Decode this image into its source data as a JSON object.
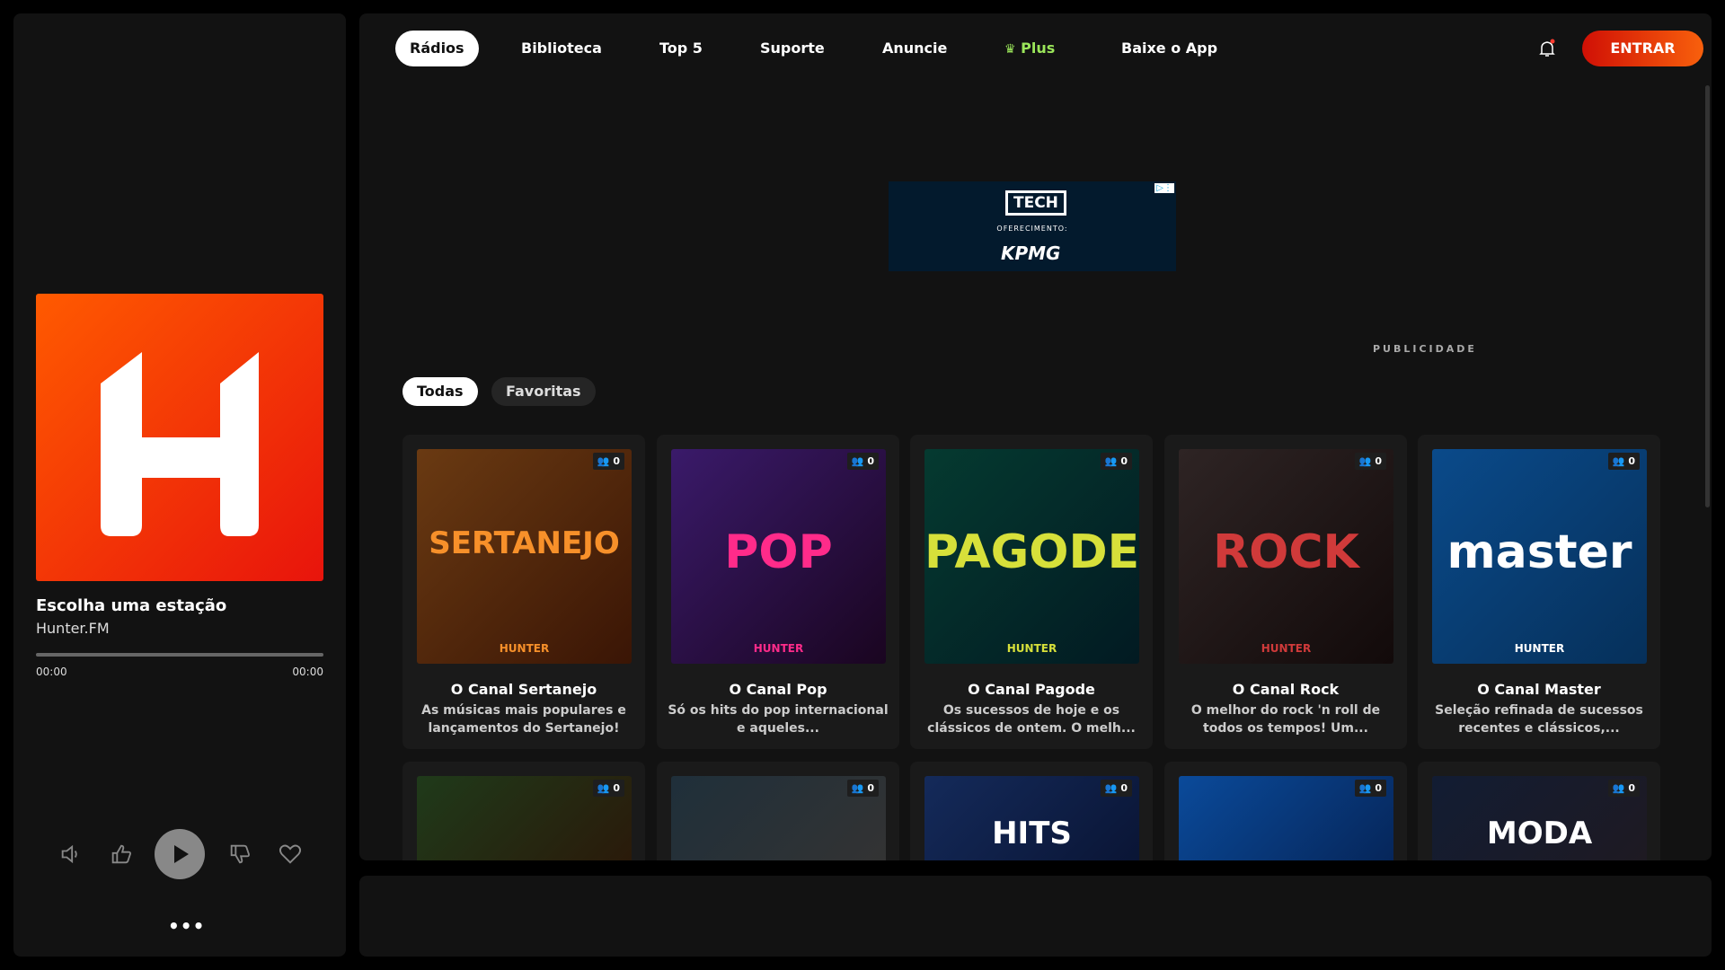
{
  "player": {
    "title": "Escolha uma estação",
    "subtitle": "Hunter.FM",
    "time_current": "00:00",
    "time_total": "00:00",
    "progress": 0
  },
  "nav": {
    "items": [
      "Rádios",
      "Biblioteca",
      "Top 5",
      "Suporte",
      "Anuncie",
      "Plus",
      "Baixe o App"
    ],
    "active": "Rádios",
    "login": "ENTRAR"
  },
  "ad": {
    "tech": "TECH",
    "offer": "OFERECIMENTO:",
    "brand": "KPMG",
    "label": "PUBLICIDADE"
  },
  "filters": [
    "Todas",
    "Favoritas"
  ],
  "colors": {
    "accent": "#e8140c",
    "plus": "#9be65a"
  },
  "stations": [
    {
      "logo": "SERTANEJO",
      "title": "O Canal Sertanejo",
      "desc": "As músicas mais populares e lançamentos do Sertanejo!",
      "listeners": "0",
      "brand": "HUNTER",
      "color": "#f7902a",
      "bg": "linear-gradient(135deg,#6a3a12,#3a1505)"
    },
    {
      "logo": "POP",
      "title": "O Canal Pop",
      "desc": "Só os hits do pop internacional e aqueles...",
      "listeners": "0",
      "brand": "HUNTER",
      "color": "#ff2b8a",
      "bg": "linear-gradient(135deg,#3a1a6a,#1a0520)"
    },
    {
      "logo": "PAGODE",
      "title": "O Canal Pagode",
      "desc": "Os sucessos de hoje e os clássicos de ontem. O melh...",
      "listeners": "0",
      "brand": "HUNTER",
      "color": "#d7e03a",
      "bg": "linear-gradient(135deg,#053a30,#021a22)"
    },
    {
      "logo": "ROCK",
      "title": "O Canal Rock",
      "desc": "O melhor do rock 'n roll de todos os tempos! Um...",
      "listeners": "0",
      "brand": "HUNTER",
      "color": "#d03a3a",
      "bg": "linear-gradient(135deg,#2e2424,#120a0a)"
    },
    {
      "logo": "master",
      "title": "O Canal Master",
      "desc": "Seleção refinada de sucessos recentes e clássicos,...",
      "listeners": "0",
      "brand": "HUNTER",
      "color": "#ffffff",
      "bg": "linear-gradient(135deg,#0a4a8a,#06305a)"
    },
    {
      "logo": "",
      "listeners": "0",
      "bg": "linear-gradient(135deg,#1f3a1a,#2a1a0a)"
    },
    {
      "logo": "",
      "listeners": "0",
      "bg": "linear-gradient(135deg,#1f2f3a,#333)"
    },
    {
      "logo": "HITS",
      "listeners": "0",
      "color": "#ffffff",
      "bg": "linear-gradient(135deg,#142a5a,#0a1535)"
    },
    {
      "logo": "",
      "listeners": "0",
      "bg": "linear-gradient(135deg,#0a4a9a,#06265a)"
    },
    {
      "logo": "MODA",
      "listeners": "0",
      "color": "#ffffff",
      "bg": "linear-gradient(135deg,#121c33,#1e1a22)"
    }
  ]
}
